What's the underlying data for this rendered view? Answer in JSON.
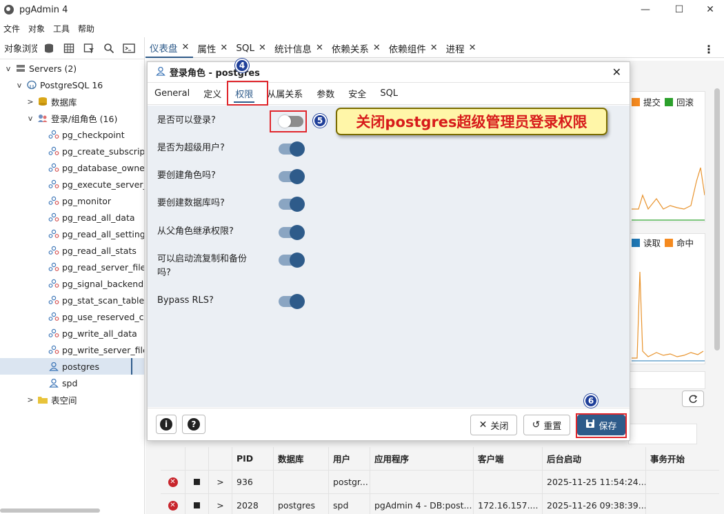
{
  "window": {
    "title": "pgAdmin 4",
    "minimize": "—",
    "maximize": "☐",
    "close": "✕"
  },
  "menu": [
    "文件",
    "对象",
    "工具",
    "帮助"
  ],
  "browser": {
    "title": "对象浏览器",
    "tree": [
      {
        "label": "Servers (2)",
        "depth": 0,
        "chevron": "v",
        "icon": "servers-icon"
      },
      {
        "label": "PostgreSQL 16",
        "depth": 1,
        "chevron": "v",
        "icon": "elephant-icon"
      },
      {
        "label": "数据库",
        "depth": 2,
        "chevron": ">",
        "icon": "database-icon"
      },
      {
        "label": "登录/组角色 (16)",
        "depth": 2,
        "chevron": "v",
        "icon": "role-group-icon"
      },
      {
        "label": "pg_checkpoint",
        "depth": 3,
        "icon": "group-role-icon"
      },
      {
        "label": "pg_create_subscript",
        "depth": 3,
        "icon": "group-role-icon"
      },
      {
        "label": "pg_database_owner",
        "depth": 3,
        "icon": "group-role-icon"
      },
      {
        "label": "pg_execute_server_p",
        "depth": 3,
        "icon": "group-role-icon"
      },
      {
        "label": "pg_monitor",
        "depth": 3,
        "icon": "group-role-icon"
      },
      {
        "label": "pg_read_all_data",
        "depth": 3,
        "icon": "group-role-icon"
      },
      {
        "label": "pg_read_all_settings",
        "depth": 3,
        "icon": "group-role-icon"
      },
      {
        "label": "pg_read_all_stats",
        "depth": 3,
        "icon": "group-role-icon"
      },
      {
        "label": "pg_read_server_files",
        "depth": 3,
        "icon": "group-role-icon"
      },
      {
        "label": "pg_signal_backend",
        "depth": 3,
        "icon": "group-role-icon"
      },
      {
        "label": "pg_stat_scan_tables",
        "depth": 3,
        "icon": "group-role-icon"
      },
      {
        "label": "pg_use_reserved_co",
        "depth": 3,
        "icon": "group-role-icon"
      },
      {
        "label": "pg_write_all_data",
        "depth": 3,
        "icon": "group-role-icon"
      },
      {
        "label": "pg_write_server_files",
        "depth": 3,
        "icon": "group-role-icon"
      },
      {
        "label": "postgres",
        "depth": 3,
        "icon": "login-role-icon",
        "selected": true
      },
      {
        "label": "spd",
        "depth": 3,
        "icon": "login-role-icon"
      },
      {
        "label": "表空间",
        "depth": 2,
        "chevron": ">",
        "icon": "tablespace-icon"
      }
    ]
  },
  "tabs": [
    {
      "label": "仪表盘",
      "active": true
    },
    {
      "label": "属性"
    },
    {
      "label": "SQL"
    },
    {
      "label": "统计信息"
    },
    {
      "label": "依赖关系"
    },
    {
      "label": "依赖组件"
    },
    {
      "label": "进程"
    }
  ],
  "dashboard": {
    "legend1": [
      {
        "label": "提交",
        "color": "#f58a1f"
      },
      {
        "label": "回滚",
        "color": "#2ca02c"
      }
    ],
    "legend2": [
      {
        "label": "读取",
        "color": "#1f77b4"
      },
      {
        "label": "命中",
        "color": "#f58a1f"
      }
    ],
    "sessions": {
      "columns": [
        "PID",
        "数据库",
        "用户",
        "应用程序",
        "客户端",
        "后台启动",
        "事务开始"
      ],
      "rows": [
        [
          "936",
          "",
          "postgr...",
          "",
          "",
          "2025-11-25 11:54:24...",
          ""
        ],
        [
          "2028",
          "postgres",
          "spd",
          "pgAdmin 4 - DB:post...",
          "172.16.157....",
          "2025-11-26 09:38:39...",
          ""
        ]
      ]
    }
  },
  "dialog": {
    "title": "登录角色 - postgres",
    "tabs": [
      "General",
      "定义",
      "权限",
      "从属关系",
      "参数",
      "安全",
      "SQL"
    ],
    "active_tab": "权限",
    "privileges": [
      {
        "label": "是否可以登录?",
        "value": false
      },
      {
        "label": "是否为超级用户?",
        "value": true
      },
      {
        "label": "要创建角色吗?",
        "value": true
      },
      {
        "label": "要创建数据库吗?",
        "value": true
      },
      {
        "label": "从父角色继承权限?",
        "value": true
      },
      {
        "label": "可以启动流复制和备份吗?",
        "value": true
      },
      {
        "label": "Bypass RLS?",
        "value": true
      }
    ],
    "footer": {
      "info": "i",
      "help": "?",
      "close": "关闭",
      "reset": "重置",
      "save": "保存"
    }
  },
  "annotations": {
    "step4": "4",
    "step5": "5",
    "step6": "6",
    "callout": "关闭postgres超级管理员登录权限"
  },
  "colors": {
    "accent": "#2e5b8a",
    "annotation_red": "#e0262c",
    "badge_blue": "#1f3f99"
  }
}
